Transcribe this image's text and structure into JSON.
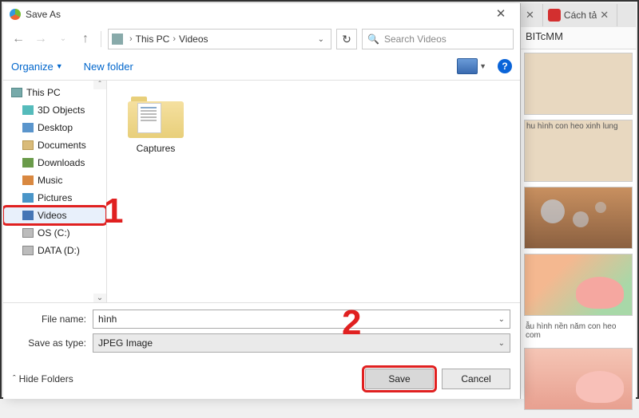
{
  "dialog": {
    "title": "Save As",
    "close": "✕"
  },
  "nav": {
    "back": "←",
    "fwd": "→",
    "up": "↑",
    "refresh": "↻",
    "breadcrumb": [
      "This PC",
      "Videos"
    ],
    "search_placeholder": "Search Videos"
  },
  "toolbar": {
    "organize": "Organize",
    "new_folder": "New folder",
    "help": "?"
  },
  "tree": {
    "items": [
      {
        "label": "This PC",
        "icon": "pc",
        "child": false
      },
      {
        "label": "3D Objects",
        "icon": "obj3d",
        "child": true
      },
      {
        "label": "Desktop",
        "icon": "desktop",
        "child": true
      },
      {
        "label": "Documents",
        "icon": "docs",
        "child": true
      },
      {
        "label": "Downloads",
        "icon": "down",
        "child": true
      },
      {
        "label": "Music",
        "icon": "music",
        "child": true
      },
      {
        "label": "Pictures",
        "icon": "pics",
        "child": true
      },
      {
        "label": "Videos",
        "icon": "videos",
        "child": true,
        "selected": true
      },
      {
        "label": "OS (C:)",
        "icon": "disk",
        "child": true
      },
      {
        "label": "DATA (D:)",
        "icon": "disk",
        "child": true
      }
    ]
  },
  "files": {
    "items": [
      {
        "name": "Captures"
      }
    ]
  },
  "form": {
    "filename_label": "File name:",
    "filename_value": "hình",
    "saveastype_label": "Save as type:",
    "saveastype_value": "JPEG Image"
  },
  "actions": {
    "hide_folders": "Hide Folders",
    "save": "Save",
    "cancel": "Cancel"
  },
  "browser": {
    "tab_close": "✕",
    "tab_label": "Cách tả",
    "addr": "BITcMM",
    "captions": [
      "hu hình con heo xinh lung",
      "ẫu hình nền năm con heo",
      "com"
    ]
  },
  "annotations": {
    "a1": "1",
    "a2": "2"
  }
}
